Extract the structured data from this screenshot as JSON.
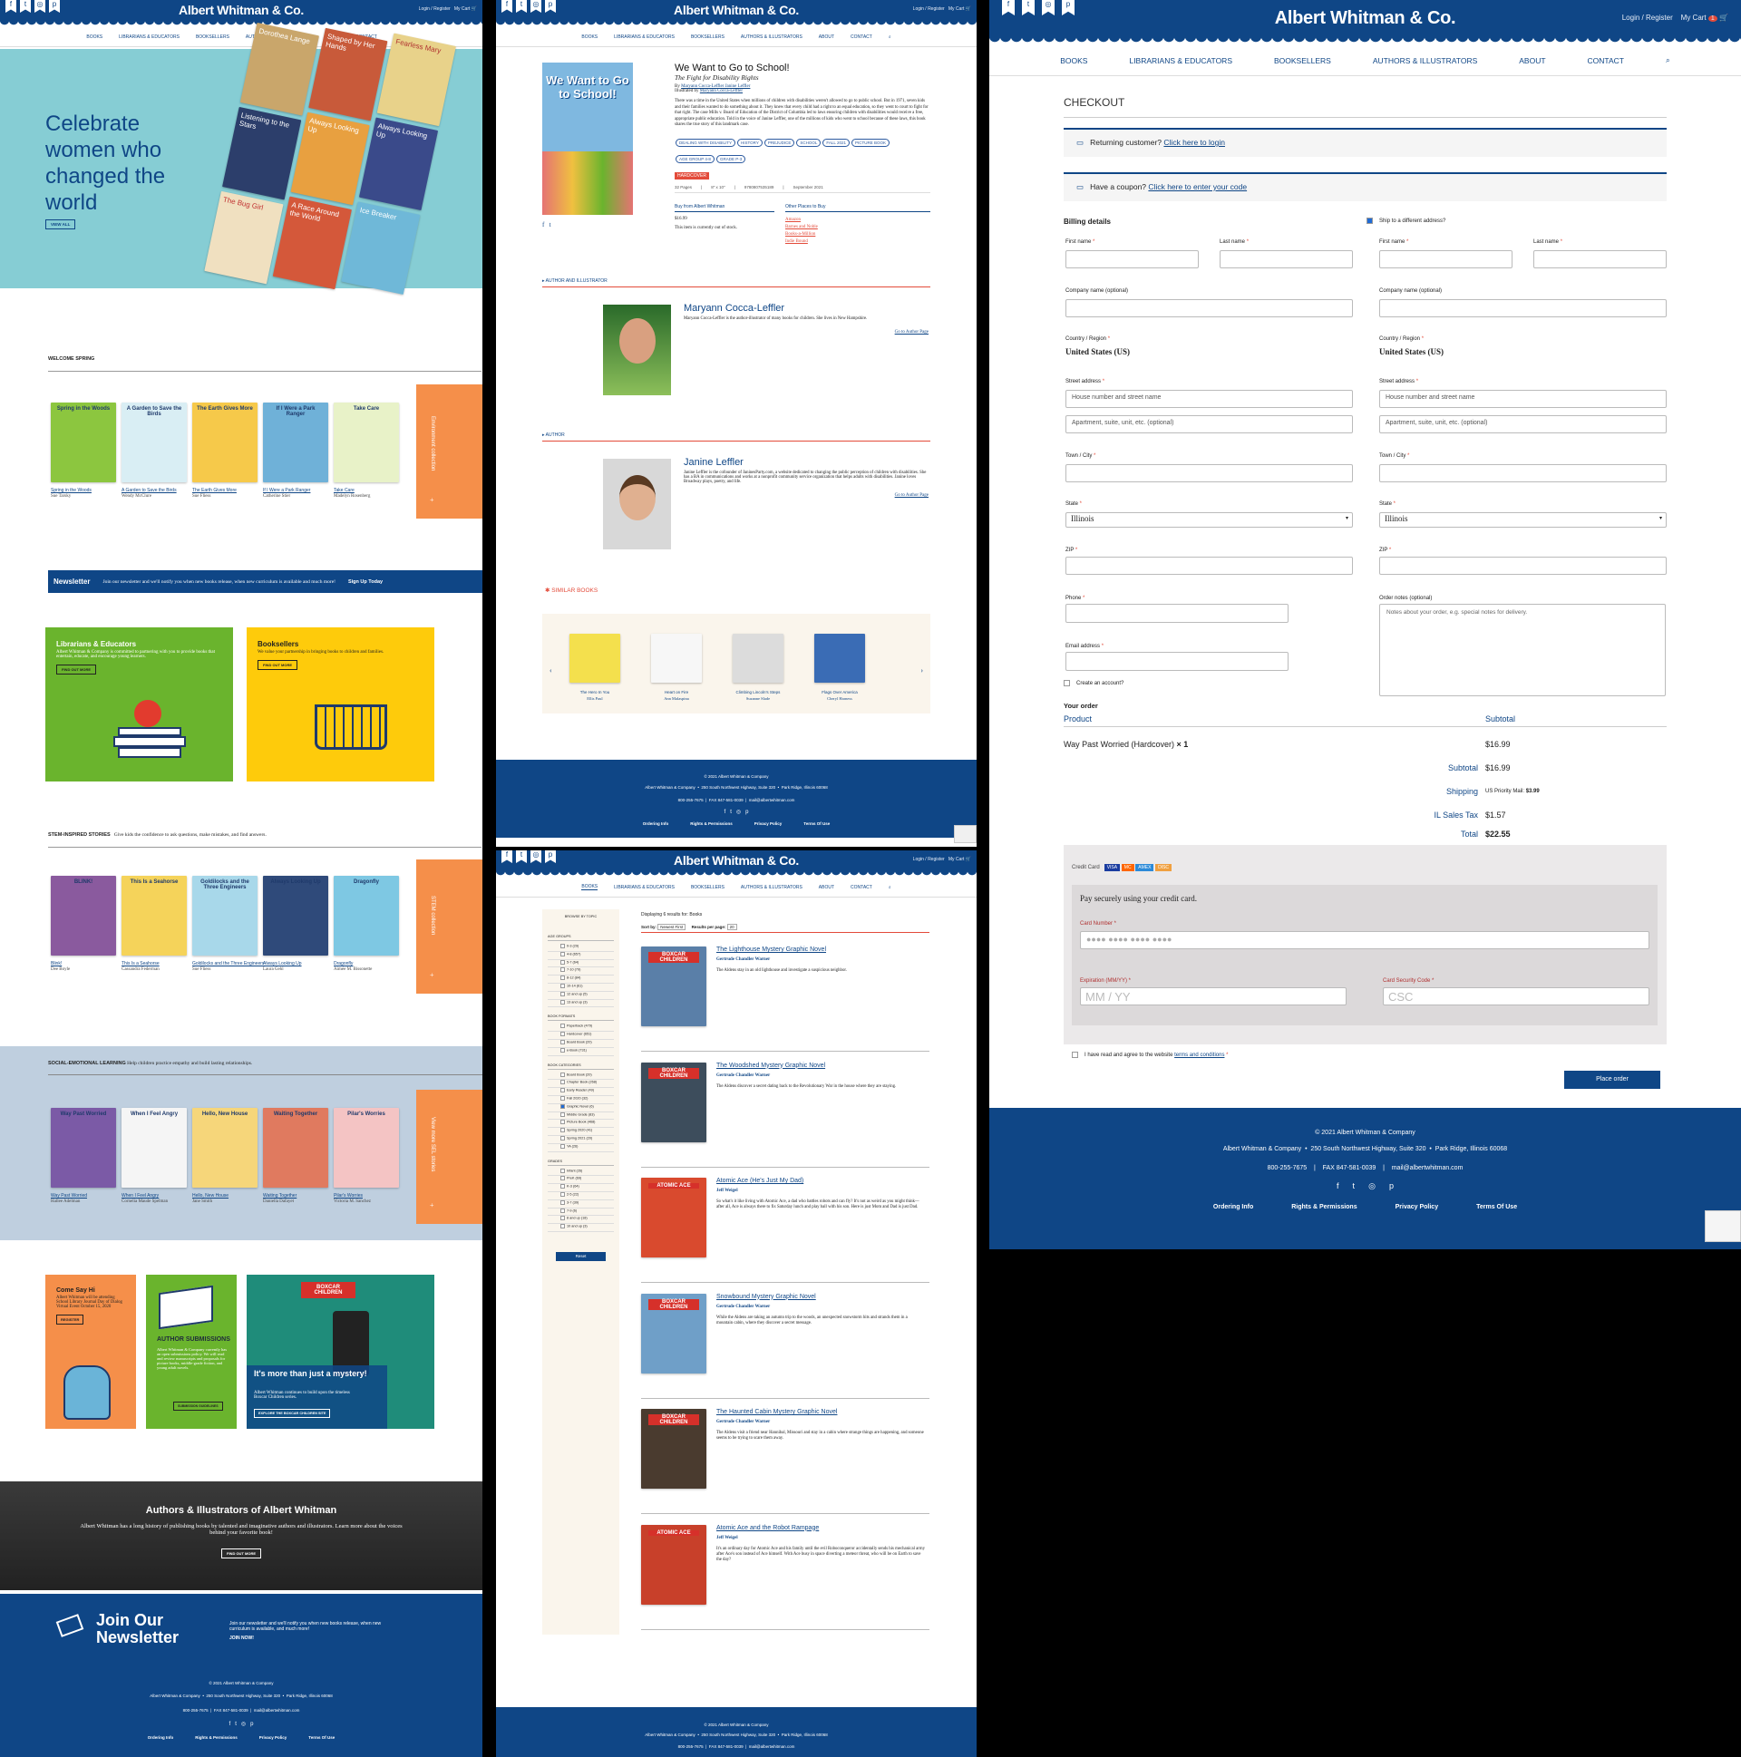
{
  "brand": {
    "name": "Albert Whitman & Co.",
    "login": "Login / Register",
    "cart": "My Cart",
    "cart_count": "1"
  },
  "nav": [
    "BOOKS",
    "LIBRARIANS & EDUCATORS",
    "BOOKSELLERS",
    "AUTHORS & ILLUSTRATORS",
    "ABOUT",
    "CONTACT"
  ],
  "home": {
    "hero_title": "Celebrate women who changed the world",
    "hero_button": "VIEW ALL",
    "hero_books": [
      "Dorothea Lange",
      "Shaped by Her Hands",
      "Fearless Mary",
      "Listening to the Stars",
      "Always Looking Up",
      "The Bug Girl",
      "A Race Around the World",
      "Ice Breaker"
    ],
    "spring": {
      "heading": "WELCOME SPRING",
      "side": "Environment collection",
      "books": [
        {
          "title": "Spring in the Woods",
          "author": "Sue Tarsky",
          "cover": "Spring in the Woods",
          "color": "#8cc63f"
        },
        {
          "title": "A Garden to Save the Birds",
          "author": "Wendy McClure",
          "cover": "A Garden to Save the Birds",
          "color": "#d9eef4"
        },
        {
          "title": "The Earth Gives More",
          "author": "Sue Fliess",
          "cover": "The Earth Gives More",
          "color": "#f6c94a"
        },
        {
          "title": "If I Were a Park Ranger",
          "author": "Catherine Stier",
          "cover": "If I Were a Park Ranger",
          "color": "#6fb1d8"
        },
        {
          "title": "Take Care",
          "author": "Madelyn Rosenberg",
          "cover": "Take Care",
          "color": "#e8f2c8"
        }
      ]
    },
    "newsletter_bar": {
      "title": "Newsletter",
      "text": "Join our newsletter and we'll notify you when new books release, when new curriculum is available and much more!",
      "cta": "Sign Up Today"
    },
    "librarians": {
      "title": "Librarians & Educators",
      "text": "Albert Whitman & Company is committed to partnering with you to provide books that entertain, educate, and encourage young learners.",
      "button": "FIND OUT MORE"
    },
    "booksellers": {
      "title": "Booksellers",
      "text": "We value your partnership in bringing books to children and families.",
      "button": "FIND OUT MORE"
    },
    "stem": {
      "heading": "STEM-INSPIRED STORIES",
      "sub": "Give kids the confidence to ask questions, make mistakes, and find answers.",
      "side": "STEM collection",
      "books": [
        {
          "title": "Blink!",
          "author": "Dee Boyle",
          "cover": "BLINK!",
          "color": "#8a5a9e"
        },
        {
          "title": "This Is a Seahorse",
          "author": "Cassandra Federman",
          "cover": "This Is a Seahorse",
          "color": "#f5d35a"
        },
        {
          "title": "Goldilocks and the Three Engineers",
          "author": "Sue Fliess",
          "cover": "Goldilocks and the Three Engineers",
          "color": "#a8d8ea"
        },
        {
          "title": "Always Looking Up",
          "author": "Laura Gehl",
          "cover": "Always Looking Up",
          "color": "#2f4a7a"
        },
        {
          "title": "Dragonfly",
          "author": "Aimée M. Bissonette",
          "cover": "Dragonfly",
          "color": "#7ec8e3"
        }
      ]
    },
    "sel": {
      "heading": "SOCIAL-EMOTIONAL LEARNING",
      "sub": "Help children practice empathy and build lasting relationships.",
      "side": "View more SEL stories",
      "books": [
        {
          "title": "Way Past Worried",
          "author": "Hallee Adelman",
          "cover": "Way Past Worried",
          "color": "#7b5aa6"
        },
        {
          "title": "When I Feel Angry",
          "author": "Cornelia Maude Spelman",
          "cover": "When I Feel Angry",
          "color": "#f5f5f5"
        },
        {
          "title": "Hello, New House",
          "author": "Jane Smith",
          "cover": "Hello, New House",
          "color": "#f6d67a"
        },
        {
          "title": "Waiting Together",
          "author": "Daniella Dafayet",
          "cover": "Waiting Together",
          "color": "#e07a5f"
        },
        {
          "title": "Pilar's Worries",
          "author": "Victoria M. Sanchez",
          "cover": "Pilar's Worries",
          "color": "#f4c4c4"
        }
      ]
    },
    "come_say_hi": {
      "title": "Come Say Hi",
      "text": "Albert Whitman will be attending School Library Journal Day of Dialog Virtual Event October 15, 2020",
      "button": "REGISTER"
    },
    "submissions": {
      "title": "AUTHOR SUBMISSIONS",
      "text": "Albert Whitman & Company currently has an open submissions policy. We will read and review manuscripts and proposals for picture books, middle-grade fiction, and young adult novels.",
      "button": "SUBMISSION GUIDELINES"
    },
    "boxcar": {
      "logo": "BOXCAR CHILDREN",
      "title": "It's more than just a mystery!",
      "text": "Albert Whitman continues to build upon the timeless Boxcar Children series.",
      "button": "EXPLORE THE BOXCAR CHILDREN SITE"
    },
    "authors_banner": {
      "title": "Authors & Illustrators of Albert Whitman",
      "text": "Albert Whitman has a long history of publishing books by talented and imaginative authors and illustrators. Learn more about the voices behind your favorite book!",
      "button": "FIND OUT MORE"
    },
    "join": {
      "title": "Join Our Newsletter",
      "text": "Join our newsletter and we'll notify you when new books release, when new curriculum is available, and much more!",
      "cta": "JOIN NOW!"
    }
  },
  "footer": {
    "copyright": "© 2021 Albert Whitman & Company",
    "company": "Albert Whitman & Company",
    "address": "250 South Northwest Highway, Suite 320",
    "city": "Park Ridge, Illinois 60068",
    "phone": "800-255-7675",
    "fax": "FAX 847-581-0039",
    "email": "mail@albertwhitman.com",
    "links": [
      "Ordering Info",
      "Rights & Permissions",
      "Privacy Policy",
      "Terms Of Use"
    ]
  },
  "product": {
    "title": "We Want to Go to School!",
    "subtitle": "The Fight for Disability Rights",
    "by_label": "By",
    "authors": "Maryann Cocca-Leffler Janine Leffler",
    "illus_label": "Illustrated by",
    "illustrator": "Maryann Cocca-Leffler",
    "description": "There was a time in the United States when millions of children with disabilities weren't allowed to go to public school. But in 1971, seven kids and their families wanted to do something about it. They knew that every child had a right to an equal education, so they went to court to fight for that right. The case Mills v. Board of Education of the District of Columbia led to laws ensuring children with disabilities would receive a free, appropriate public education. Told in the voice of Janine Leffler, one of the millions of kids who went to school because of these laws, this book shares the true story of this landmark case.",
    "tags": [
      "DEALING WITH DISABILITY",
      "HISTORY",
      "PREJUDICE",
      "SCHOOL",
      "FALL 2021",
      "PICTURE BOOK",
      "AGE GROUP 4-8",
      "GRADE P-3"
    ],
    "format": "HARDCOVER",
    "pages": "32 Pages",
    "size": "8\" x 10\"",
    "isbn": "9780807535189",
    "date": "September 2021",
    "buy_heading": "Buy from Albert Whitman",
    "price": "$16.99",
    "stock": "This item is currently out of stock.",
    "other_heading": "Other Places to Buy",
    "retailers": [
      "Amazon",
      "Barnes and Noble",
      "Books-a-Million",
      "Indie Bound"
    ],
    "cover_title": "We Want to Go to School!",
    "author_label": "AUTHOR AND ILLUSTRATOR",
    "author1": {
      "name": "Maryann Cocca-Leffler",
      "bio": "Maryann Cocca-Leffler is the author-illustrator of many books for children. She lives in New Hampshire.",
      "link": "Go to Author Page"
    },
    "author2_label": "AUTHOR",
    "author2": {
      "name": "Janine Leffler",
      "bio": "Janine Leffler is the cofounder of JaninesParty.com, a website dedicated to changing the public perception of children with disabilities. She has a BA in communications and works at a nonprofit community service organization that helps adults with disabilities. Janine loves Broadway plays, poetry, and life.",
      "link": "Go to Author Page"
    },
    "similar_heading": "SIMILAR BOOKS",
    "similar": [
      {
        "title": "The Hero In You",
        "author": "Ellis Paul",
        "color": "#f4e04d"
      },
      {
        "title": "Heart on Fire",
        "author": "Ann Malaspina",
        "color": "#f7f7f7"
      },
      {
        "title": "Climbing Lincoln's Steps",
        "author": "Suzanne Slade",
        "color": "#dcdcdc"
      },
      {
        "title": "Flags Over America",
        "author": "Cheryl Harness",
        "color": "#3a6cb5"
      }
    ]
  },
  "catalog": {
    "count": "Displaying 6 results for: Books",
    "sort_label": "Sort by:",
    "sort_value": "Newest First",
    "per_label": "Results per page:",
    "per_value": "20",
    "browse": "BROWSE BY TOPIC",
    "age_heading": "AGE GROUPS",
    "ages": [
      "0-3 (29)",
      "4-8 (657)",
      "5-7 (64)",
      "7-10 (79)",
      "8-12 (84)",
      "10-14 (61)",
      "12 and up (5)",
      "13 and up (3)"
    ],
    "format_heading": "BOOK FORMATS",
    "formats": [
      "Paperback (479)",
      "Hardcover (651)",
      "Board Book (20)",
      "e-Book (731)"
    ],
    "cat_heading": "BOOK CATEGORIES",
    "cats": [
      "Board Book (20)",
      "Chapter Book (268)",
      "Early Reader (49)",
      "Fall 2020 (32)",
      "Graphic Novel (6)",
      "Middle Grade (83)",
      "Picture Book (468)",
      "Spring 2020 (41)",
      "Spring 2021 (20)",
      "YA (26)"
    ],
    "grade_heading": "GRADES",
    "grades": [
      "Infant (26)",
      "PreK (69)",
      "K-3 (64)",
      "2-5 (22)",
      "3-7 (39)",
      "7-9 (6)",
      "8 and up (18)",
      "10 and up (3)"
    ],
    "reset": "Reset",
    "results": [
      {
        "title": "The Lighthouse Mystery Graphic Novel",
        "author": "Gertrude Chandler Warner",
        "desc": "The Aldens stay in an old lighthouse and investigate a suspicious neighbor.",
        "cover": "BOXCAR CHILDREN",
        "color": "#5a7fa8"
      },
      {
        "title": "The Woodshed Mystery Graphic Novel",
        "author": "Gertrude Chandler Warner",
        "desc": "The Aldens discover a secret dating back to the Revolutionary War in the house where they are staying.",
        "cover": "BOXCAR CHILDREN",
        "color": "#3d4d5c"
      },
      {
        "title": "Atomic Ace (He's Just My Dad)",
        "author": "Jeff Weigel",
        "desc": "So what's it like living with Atomic Ace, a dad who battles robots and can fly? It's not as weird as you might think—after all, Ace is always there to fix Saturday lunch and play ball with his son. Here is just Mom and Dad is just Dad.",
        "cover": "ATOMIC ACE",
        "color": "#d94a2e"
      },
      {
        "title": "Snowbound Mystery Graphic Novel",
        "author": "Gertrude Chandler Warner",
        "desc": "While the Aldens are taking an autumn trip to the woods, an unexpected snowstorm hits and strands them in a mountain cabin, where they discover a secret message.",
        "cover": "BOXCAR CHILDREN",
        "color": "#6f9fc8"
      },
      {
        "title": "The Haunted Cabin Mystery Graphic Novel",
        "author": "Gertrude Chandler Warner",
        "desc": "The Aldens visit a friend near Hannibal, Missouri and stay in a cabin where strange things are happening, and someone seems to be trying to scare them away.",
        "cover": "BOXCAR CHILDREN",
        "color": "#4a3b2f"
      },
      {
        "title": "Atomic Ace and the Robot Rampage",
        "author": "Jeff Weigel",
        "desc": "It's an ordinary day for Atomic Ace and his family until the evil Roboconqueror accidentally sends his mechanical army after Ace's son instead of Ace himself. With Ace busy in space diverting a meteor threat, who will be on Earth to save the day?",
        "cover": "ATOMIC ACE",
        "color": "#c8402a"
      }
    ]
  },
  "checkout": {
    "title": "CHECKOUT",
    "returning": "Returning customer?",
    "returning_link": "Click here to login",
    "coupon": "Have a coupon?",
    "coupon_link": "Click here to enter your code",
    "billing": "Billing details",
    "ship_diff": "Ship to a different address?",
    "first": "First name",
    "last": "Last name",
    "company": "Company name (optional)",
    "country_label": "Country / Region",
    "country": "United States (US)",
    "street": "Street address",
    "street_ph": "House number and street name",
    "apt_ph": "Apartment, suite, unit, etc. (optional)",
    "town": "Town / City",
    "state": "State",
    "state_value": "Illinois",
    "zip": "ZIP",
    "phone": "Phone",
    "email": "Email address",
    "create": "Create an account?",
    "notes": "Order notes (optional)",
    "notes_ph": "Notes about your order, e.g. special notes for delivery.",
    "your_order": "Your order",
    "product_h": "Product",
    "subtotal_h": "Subtotal",
    "item": "Way Past Worried (Hardcover)",
    "qty": "× 1",
    "item_price": "$16.99",
    "subtotal_l": "Subtotal",
    "subtotal": "$16.99",
    "shipping_l": "Shipping",
    "shipping": "US Priority Mail:",
    "shipping_price": "$3.99",
    "tax_l": "IL Sales Tax",
    "tax": "$1.57",
    "total_l": "Total",
    "total": "$22.55",
    "cc_label": "Credit Card",
    "cc_logos": [
      "VISA",
      "MC",
      "AMEX",
      "DISC"
    ],
    "pay_text": "Pay securely using your credit card.",
    "card_num": "Card Number",
    "card_ph": "●●●● ●●●● ●●●● ●●●●",
    "exp": "Expiration (MM/YY)",
    "exp_ph": "MM / YY",
    "csc": "Card Security Code",
    "csc_ph": "CSC",
    "terms_pre": "I have read and agree to the website",
    "terms_link": "terms and conditions",
    "place": "Place order"
  }
}
